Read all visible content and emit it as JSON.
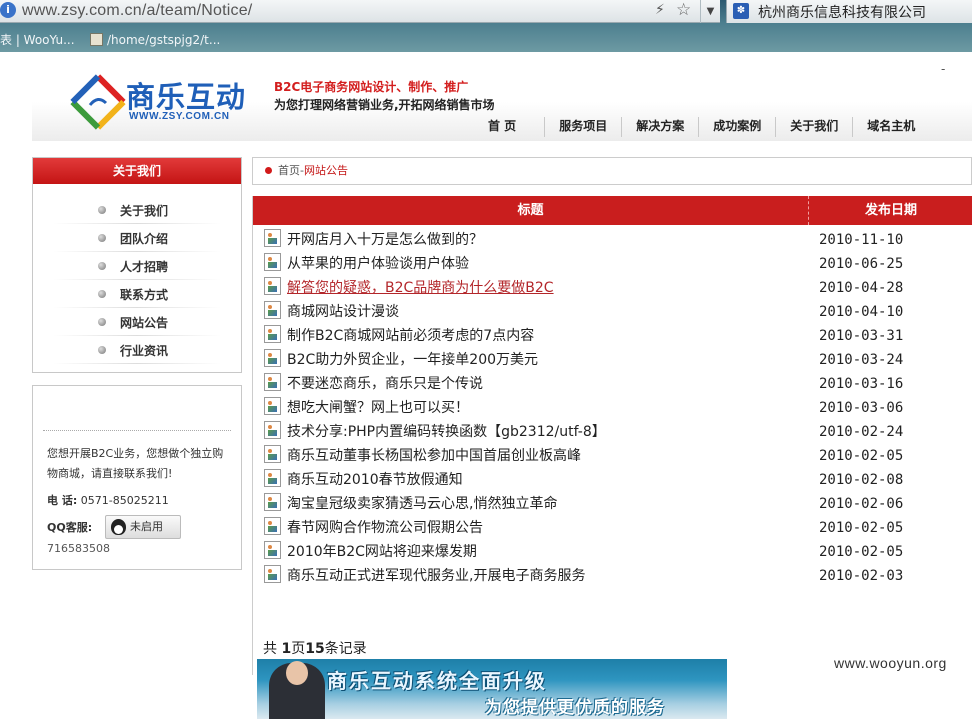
{
  "browser": {
    "url": "www.zsy.com.cn/a/team/Notice/",
    "search_engine_label": "杭州商乐信息科技有限公司",
    "tabs": [
      {
        "label": "表 | WooYu..."
      },
      {
        "label": "/home/gstspjg2/t..."
      }
    ]
  },
  "header": {
    "logo_cn": "商乐互动",
    "logo_en": "WWW.ZSY.COM.CN",
    "slogan_line1": "B2C电子商务网站设计、制作、推广",
    "slogan_line2": "为您打理网络营销业务,开拓网络销售市场",
    "corner_mark": "-",
    "nav": [
      {
        "label": "首 页"
      },
      {
        "label": "服务项目"
      },
      {
        "label": "解决方案"
      },
      {
        "label": "成功案例"
      },
      {
        "label": "关于我们"
      },
      {
        "label": "域名主机"
      }
    ]
  },
  "sidebar": {
    "title": "关于我们",
    "items": [
      {
        "label": "关于我们"
      },
      {
        "label": "团队介绍"
      },
      {
        "label": "人才招聘"
      },
      {
        "label": "联系方式"
      },
      {
        "label": "网站公告"
      },
      {
        "label": "行业资讯"
      }
    ],
    "contact": {
      "intro": "您想开展B2C业务，您想做个独立购物商城，请直接联系我们!",
      "phone_label": "电 话:",
      "phone": "0571-85025211",
      "qq_label": "QQ客服:",
      "qq_button": "未启用",
      "qq_number": "716583508"
    }
  },
  "breadcrumb": {
    "home": "首页",
    "separator": "-",
    "current": "网站公告"
  },
  "table": {
    "col_title": "标题",
    "col_date": "发布日期",
    "rows": [
      {
        "title": "开网店月入十万是怎么做到的？",
        "date": "2010-11-10"
      },
      {
        "title": "从苹果的用户体验谈用户体验",
        "date": "2010-06-25"
      },
      {
        "title": "解答您的疑惑，B2C品牌商为什么要做B2C",
        "date": "2010-04-28"
      },
      {
        "title": "商城网站设计漫谈",
        "date": "2010-04-10"
      },
      {
        "title": "制作B2C商城网站前必须考虑的7点内容",
        "date": "2010-03-31"
      },
      {
        "title": "B2C助力外贸企业，一年接单200万美元",
        "date": "2010-03-24"
      },
      {
        "title": "不要迷恋商乐，商乐只是个传说",
        "date": "2010-03-16"
      },
      {
        "title": "想吃大闸蟹？网上也可以买！",
        "date": "2010-03-06"
      },
      {
        "title": "技术分享:PHP内置编码转换函数【gb2312/utf-8】",
        "date": "2010-02-24"
      },
      {
        "title": "商乐互动董事长杨国松参加中国首届创业板高峰",
        "date": "2010-02-05"
      },
      {
        "title": "商乐互动2010春节放假通知",
        "date": "2010-02-08"
      },
      {
        "title": "淘宝皇冠级卖家猜透马云心思,悄然独立革命",
        "date": "2010-02-06"
      },
      {
        "title": "春节网购合作物流公司假期公告",
        "date": "2010-02-05"
      },
      {
        "title": "2010年B2C网站将迎来爆发期",
        "date": "2010-02-05"
      },
      {
        "title": "商乐互动正式进军现代服务业,开展电子商务服务",
        "date": "2010-02-03"
      }
    ],
    "pager": {
      "prefix": "共 ",
      "pages": "1",
      "mid": "页",
      "records": "15",
      "suffix": "条记录"
    }
  },
  "banner": {
    "line1": "商乐互动系统全面升级",
    "line2": "为您提供更优质的服务"
  },
  "watermark": "www.wooyun.org",
  "colors": {
    "brand_red": "#c91e1e",
    "logo_blue": "#1f5fb8",
    "link_hover": "#b3262a"
  }
}
